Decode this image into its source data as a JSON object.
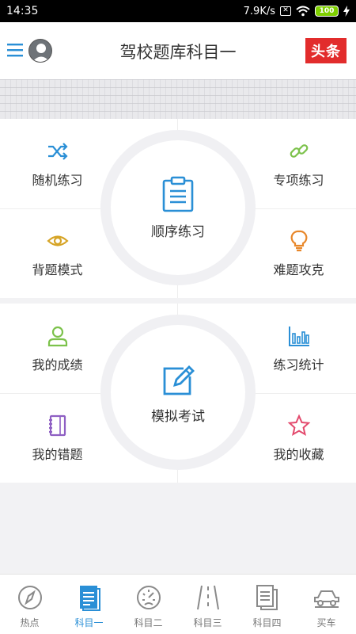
{
  "status": {
    "time": "14:35",
    "speed": "7.9K/s",
    "battery": "100"
  },
  "header": {
    "title": "驾校题库科目一",
    "brand": "头条"
  },
  "practice": {
    "center": "顺序练习",
    "items": [
      "随机练习",
      "专项练习",
      "背题模式",
      "难题攻克"
    ]
  },
  "exam": {
    "center": "模拟考试",
    "items": [
      "我的成绩",
      "练习统计",
      "我的错题",
      "我的收藏"
    ]
  },
  "tabs": [
    {
      "label": "热点",
      "icon": "compass-icon"
    },
    {
      "label": "科目一",
      "icon": "document-icon",
      "active": true
    },
    {
      "label": "科目二",
      "icon": "speedometer-icon"
    },
    {
      "label": "科目三",
      "icon": "road-icon"
    },
    {
      "label": "科目四",
      "icon": "copy-icon"
    },
    {
      "label": "买车",
      "icon": "car-icon"
    }
  ],
  "colors": {
    "accent": "#2a8fd6",
    "brand": "#e22c2c",
    "green": "#7cc24b",
    "gold": "#d6a426",
    "orange": "#e8872a",
    "purple": "#8e5fc3",
    "pink": "#e34a6d"
  }
}
